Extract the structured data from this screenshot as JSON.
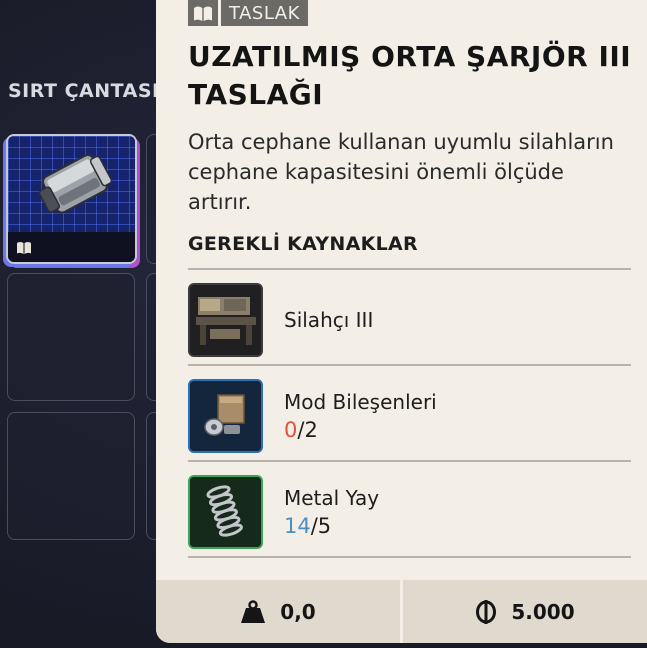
{
  "inventory": {
    "section_title": "SIRT ÇANTASI"
  },
  "item": {
    "tag": "TASLAK",
    "title": "UZATILMIŞ ORTA ŞARJÖR III TASLAĞI",
    "description": "Orta cephane kullanan uyumlu silahların cephane kapasitesini önemli ölçüde artırır."
  },
  "requirements": {
    "title": "GEREKLİ KAYNAKLAR",
    "items": [
      {
        "name": "Silahçı III",
        "icon": "workbench-icon",
        "frame_color": "#3b3b3b"
      },
      {
        "name": "Mod Bileşenleri",
        "have": "0",
        "need": "/2",
        "have_color": "#e0523a",
        "icon": "mod-components-icon",
        "frame_color": "#2e6fb5"
      },
      {
        "name": "Metal Yay",
        "have": "14",
        "need": "/5",
        "have_color": "#4a8fc0",
        "icon": "metal-spring-icon",
        "frame_color": "#3aa55a"
      }
    ]
  },
  "footer": {
    "weight": "0,0",
    "price": "5.000",
    "weight_icon": "weight-icon",
    "price_icon": "coin-icon"
  }
}
